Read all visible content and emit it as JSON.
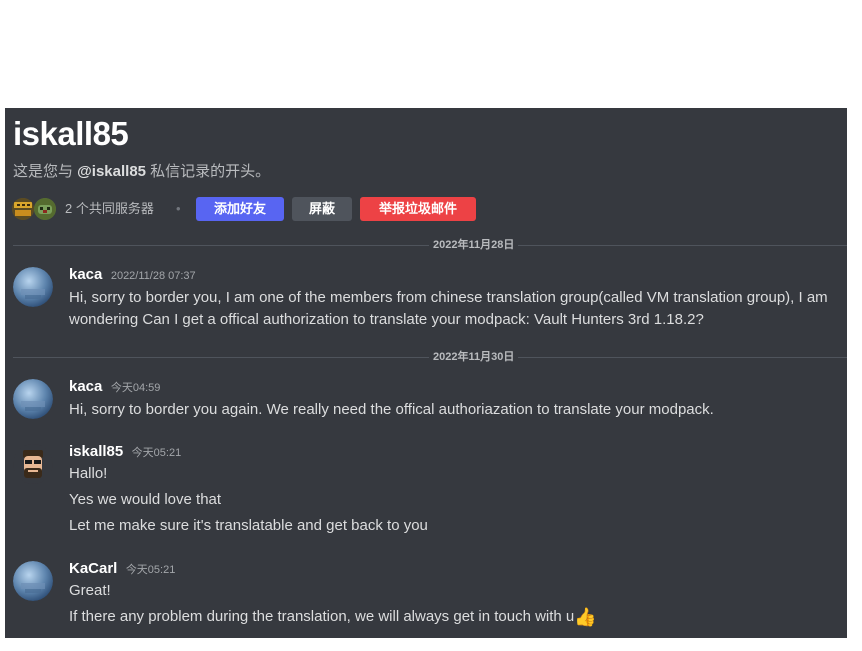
{
  "dm": {
    "title": "iskall85",
    "intro_prefix": "这是您与 ",
    "intro_user": "@iskall85",
    "intro_suffix": " 私信记录的开头。",
    "mutual_servers": "2 个共同服务器",
    "separator": "•"
  },
  "actions": {
    "add_friend": "添加好友",
    "block": "屏蔽",
    "report_spam": "举报垃圾邮件"
  },
  "dividers": [
    "2022年11月28日",
    "2022年11月30日"
  ],
  "messages": [
    {
      "author": "kaca",
      "timestamp": "2022/11/28 07:37",
      "lines": [
        "Hi, sorry to border you, I am one of the members from chinese translation group(called VM translation group), I am",
        "wondering Can I get a  offical authorization to translate your modpack: Vault Hunters 3rd 1.18.2?"
      ]
    },
    {
      "author": "kaca",
      "timestamp": "今天04:59",
      "lines": [
        "Hi, sorry to border you again. We really need the offical authoriazation to translate your modpack."
      ]
    },
    {
      "author": "iskall85",
      "timestamp": "今天05:21",
      "lines": [
        "Hallo!",
        "Yes we would love that",
        "Let me make sure it's translatable and get back to you"
      ]
    },
    {
      "author": "KaCarl",
      "timestamp": "今天05:21",
      "lines": [
        "Great!",
        "If there any problem during the translation, we will always get in touch with u"
      ],
      "emoji": "👍"
    }
  ],
  "colors": {
    "background": "#36393f",
    "primary_button": "#5865f2",
    "secondary_button": "#4f545c",
    "danger_button": "#ed4245"
  },
  "icons": [
    "server-icon-vault-hunters",
    "server-icon-creeper",
    "avatar-globe",
    "avatar-cartoon-face",
    "thumbs-up-emoji"
  ]
}
